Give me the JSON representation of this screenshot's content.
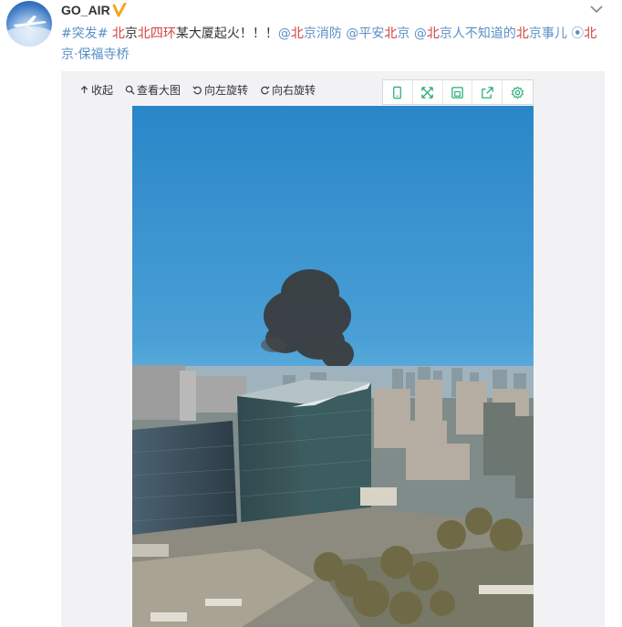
{
  "post": {
    "username": "GO_AIR",
    "text_parts": [
      {
        "t": "#突发#",
        "k": "link"
      },
      {
        "t": " ",
        "k": ""
      },
      {
        "t": "北",
        "k": "red"
      },
      {
        "t": "京",
        "k": ""
      },
      {
        "t": "北",
        "k": "red"
      },
      {
        "t": "四环",
        "k": "red"
      },
      {
        "t": "某大厦起火！！！",
        "k": ""
      },
      {
        "t": "@",
        "k": "link"
      },
      {
        "t": "北",
        "k": "red"
      },
      {
        "t": "京消防",
        "k": "link"
      },
      {
        "t": " @平安",
        "k": "link"
      },
      {
        "t": "北",
        "k": "red"
      },
      {
        "t": "京",
        "k": "link"
      },
      {
        "t": " @",
        "k": "link"
      },
      {
        "t": "北",
        "k": "red"
      },
      {
        "t": "京人不知道的",
        "k": "link"
      },
      {
        "t": "北",
        "k": "red"
      },
      {
        "t": "京事儿",
        "k": "link"
      },
      {
        "t": " ⦿",
        "k": "link"
      },
      {
        "t": "北",
        "k": "red"
      },
      {
        "t": "京·保福寺桥",
        "k": "link"
      }
    ]
  },
  "toolbar": {
    "collapse": "收起",
    "view_large": "查看大图",
    "rotate_left": "向左旋转",
    "rotate_right": "向右旋转"
  },
  "icons": [
    "phone-icon",
    "expand-icon",
    "save-icon",
    "share-icon",
    "settings-icon"
  ],
  "colors": {
    "link": "#5b8fc7",
    "highlight": "#d24040",
    "icon_green": "#2eae7a",
    "verified": "#f5a623"
  }
}
